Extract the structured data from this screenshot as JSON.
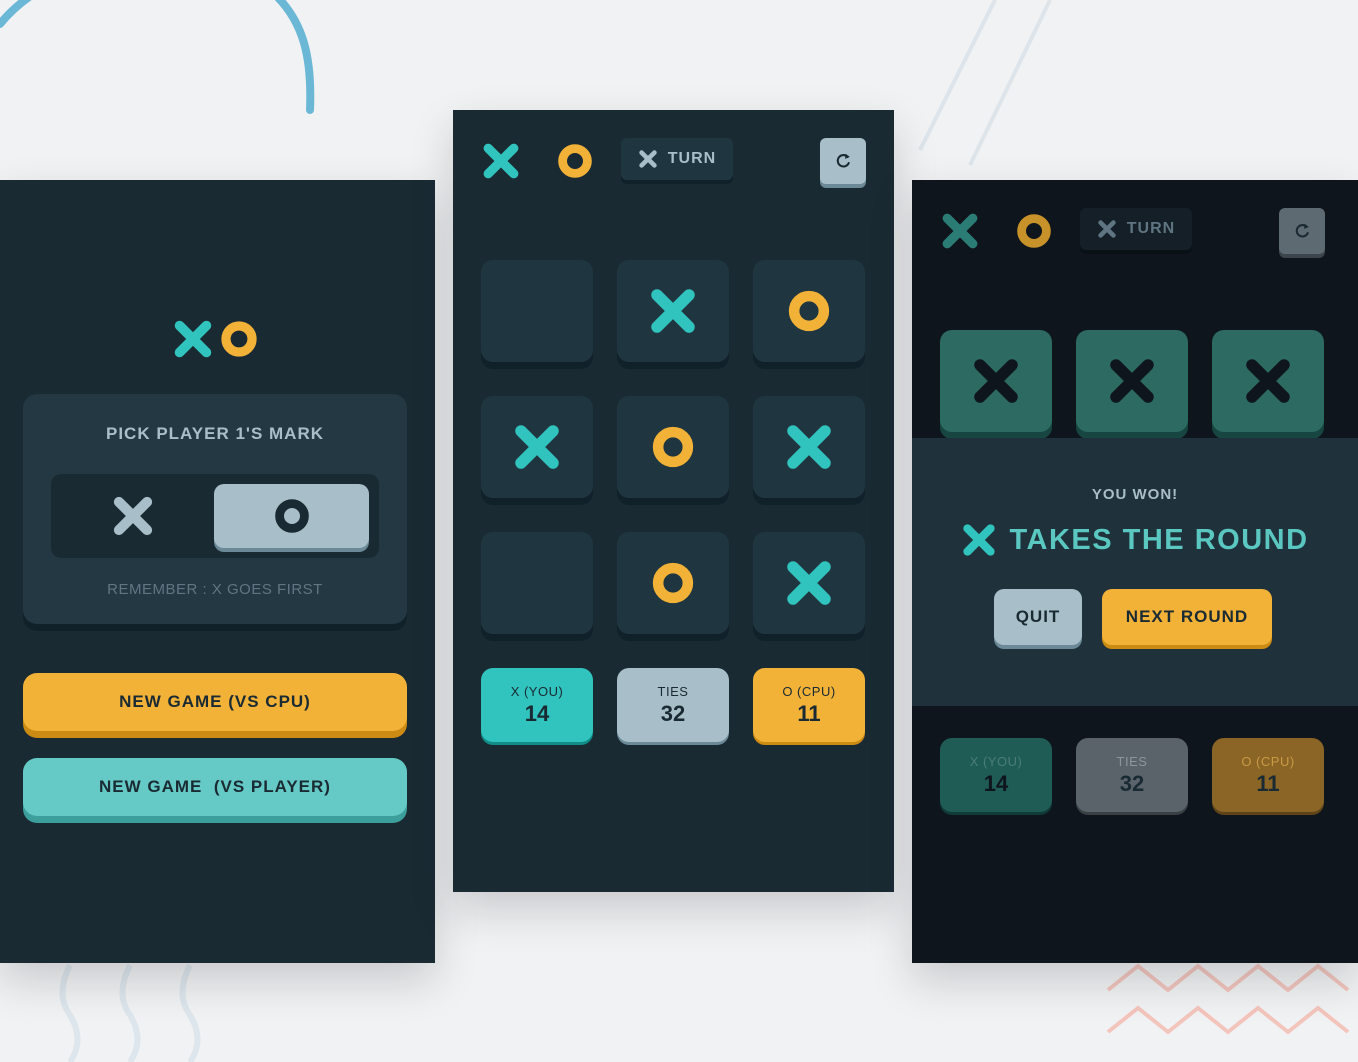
{
  "colors": {
    "background": "#f1f2f3",
    "navy": "#1a2a33",
    "semi_navy": "#1f3641",
    "teal": "#31c3bd",
    "yellow": "#f2b137",
    "silver": "#a8bfc9"
  },
  "menu_screen": {
    "logo_icons": [
      "x-mark-icon",
      "o-mark-icon"
    ],
    "mark_picker": {
      "title": "PICK PLAYER 1'S MARK",
      "options": [
        "X",
        "O"
      ],
      "selected": "O",
      "hint": "REMEMBER : X GOES FIRST"
    },
    "buttons": {
      "new_game_cpu": "NEW GAME (VS CPU)",
      "new_game_player": "NEW GAME  (VS PLAYER)"
    }
  },
  "game_screen": {
    "turn_label": "TURN",
    "turn_icon": "x-mark-icon",
    "restart_icon": "restart-icon",
    "board": [
      "",
      "X",
      "O",
      "X",
      "O",
      "X",
      "",
      "O",
      "X"
    ],
    "scores": {
      "x": {
        "label": "X (YOU)",
        "value": "14"
      },
      "ties": {
        "label": "TIES",
        "value": "32"
      },
      "o": {
        "label": "O (CPU)",
        "value": "11"
      }
    }
  },
  "result_screen": {
    "turn_label": "TURN",
    "winning_row": [
      "X",
      "X",
      "X"
    ],
    "message": "YOU WON!",
    "headline": "TAKES THE ROUND",
    "headline_icon": "x-mark-icon",
    "buttons": {
      "quit": "QUIT",
      "next_round": "NEXT ROUND"
    },
    "scores": {
      "x": {
        "label": "X (YOU)",
        "value": "14"
      },
      "ties": {
        "label": "TIES",
        "value": "32"
      },
      "o": {
        "label": "O (CPU)",
        "value": "11"
      }
    }
  }
}
